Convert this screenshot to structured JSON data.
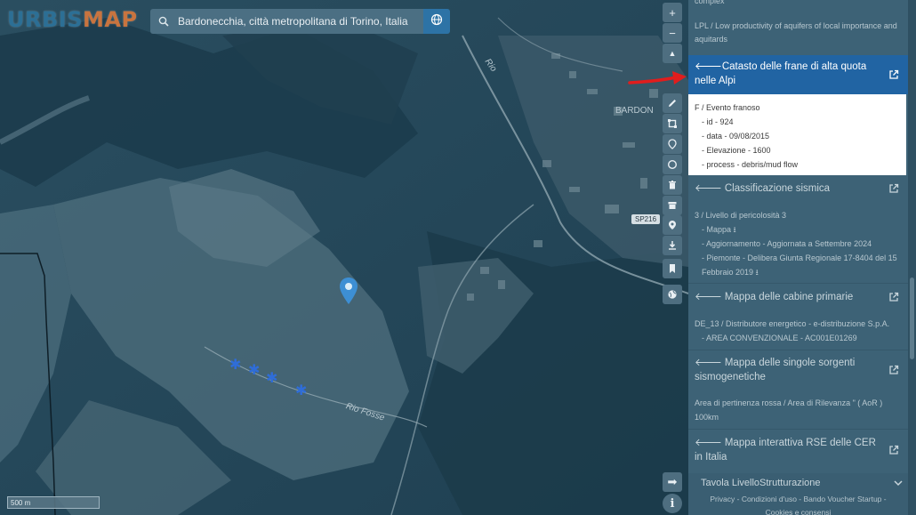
{
  "logo": {
    "part1": "URBIS",
    "part2": "MAP"
  },
  "search": {
    "value": "Bardonecchia, città metropolitana di Torino, Italia",
    "placeholder": ""
  },
  "map": {
    "place_label": "BARDON",
    "road_label_1": "Rio",
    "road_label_2": "Rio Fosse",
    "road_badge": "SP216",
    "scale": "500 m"
  },
  "toolbar": {
    "zoom_in": "+",
    "zoom_out": "−",
    "north": "▲",
    "forward": "➡",
    "info": "i"
  },
  "panel": {
    "top_snippet_1": "complex",
    "top_snippet_2": "LPL / Low productivity of aquifers of local importance and aquitards",
    "catasto": {
      "title": "Catasto delle frane di alta quota nelle Alpi",
      "line_1": "F / Evento franoso",
      "line_2": "- id - 924",
      "line_3": "- data - 09/08/2015",
      "line_4": "- Elevazione - 1600",
      "line_5": "- process - debris/mud flow"
    },
    "sismica": {
      "title": "Classificazione sismica",
      "line_1": "3 / Livello di pericolosità 3",
      "line_2": "- Mappa",
      "line_3": "- Aggiornamento - Aggiornata a Settembre 2024",
      "line_4": "- Piemonte - Delibera Giunta Regionale 17-8404 del 15 Febbraio 2019"
    },
    "cabine": {
      "title": "Mappa delle cabine primarie",
      "line_1": "DE_13 / Distributore energetico - e-distribuzione S.p.A.",
      "line_2": "- AREA CONVENZIONALE - AC001E01269"
    },
    "sorgenti": {
      "title": "Mappa delle singole sorgenti sismogenetiche",
      "line_1": "Area di pertinenza rossa / Area di Rilevanza \" ( AoR ) 100km"
    },
    "rse": {
      "title": "Mappa interattiva RSE delle CER in Italia"
    },
    "footer": {
      "tavola": "Tavola LivelloStrutturazione",
      "privacy": "Privacy",
      "condizioni": "Condizioni d'uso",
      "bando": "Bando Voucher Startup",
      "cookies": "Cookies e consensi"
    }
  },
  "colors": {
    "active_header": "#2164a3",
    "panel_bg": "#3d6276",
    "marker": "#3d8fd4",
    "stars": "#2f6dd8",
    "annotation_arrow": "#e11d1d"
  }
}
